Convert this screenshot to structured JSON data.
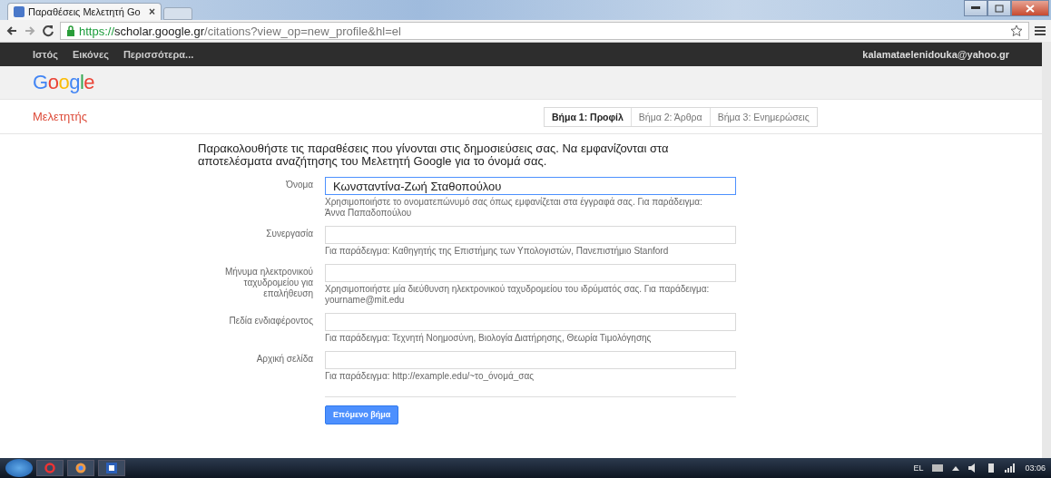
{
  "browser": {
    "tab_title": "Παραθέσεις Μελετητή Go",
    "tab_close": "×",
    "url_scheme": "https://",
    "url_host": "scholar.google.gr",
    "url_path": "/citations?view_op=new_profile&hl=el"
  },
  "top_nav": {
    "links": [
      "Ιστός",
      "Εικόνες",
      "Περισσότερα..."
    ],
    "account": "kalamataelenidouka@yahoo.gr"
  },
  "logo": "Google",
  "header": {
    "title": "Μελετητής",
    "steps": [
      {
        "label": "Βήμα 1: Προφίλ",
        "selected": true
      },
      {
        "label": "Βήμα 2: Άρθρα",
        "selected": false
      },
      {
        "label": "Βήμα 3: Ενημερώσεις",
        "selected": false
      }
    ]
  },
  "intro": "Παρακολουθήστε τις παραθέσεις που γίνονται στις δημοσιεύσεις σας. Να εμφανίζονται στα αποτελέσματα αναζήτησης του Μελετητή Google για το όνομά σας.",
  "fields": [
    {
      "label": "Όνομα",
      "value": "Κωνσταντίνα-Ζωή Σταθοπούλου",
      "focused": true,
      "hint": "Χρησιμοποιήστε το ονοματεπώνυμό σας όπως εμφανίζεται στα έγγραφά σας. Για παράδειγμα: Άννα Παπαδοπούλου"
    },
    {
      "label": "Συνεργασία",
      "focused": false,
      "hint": "Για παράδειγμα: Καθηγητής της Επιστήμης των Υπολογιστών, Πανεπιστήμιο Stanford"
    },
    {
      "label": "Μήνυμα ηλεκτρονικού ταχυδρομείου για επαλήθευση",
      "focused": false,
      "hint": "Χρησιμοποιήστε μία διεύθυνση ηλεκτρονικού ταχυδρομείου του ιδρύματός σας. Για παράδειγμα: yourname@mit.edu"
    },
    {
      "label": "Πεδία ενδιαφέροντος",
      "focused": false,
      "hint": "Για παράδειγμα: Τεχνητή Νοημοσύνη, Βιολογία Διατήρησης, Θεωρία Τιμολόγησης"
    },
    {
      "label": "Αρχική σελίδα",
      "focused": false,
      "hint": "Για παράδειγμα: http://example.edu/~το_όνομά_σας"
    }
  ],
  "next_button": "Επόμενο βήμα",
  "taskbar": {
    "language": "EL",
    "clock": "03:06"
  }
}
